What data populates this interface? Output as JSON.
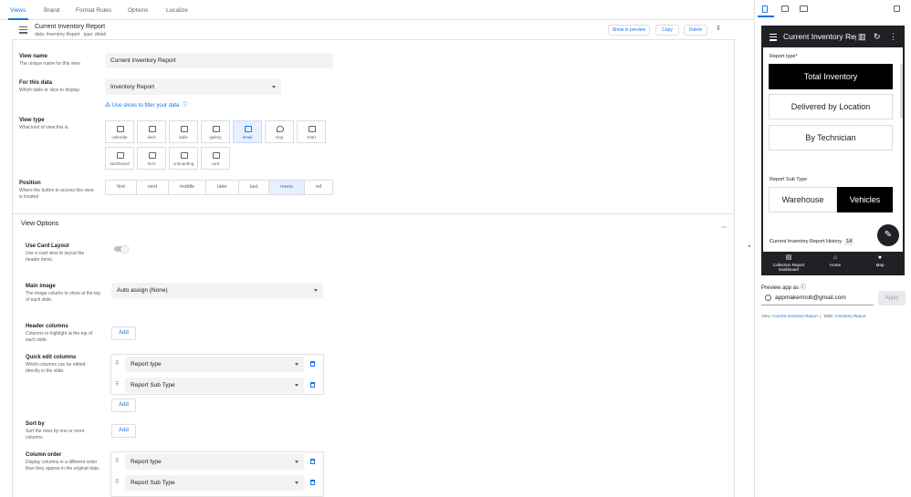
{
  "tabs": [
    "Views",
    "Brand",
    "Format Rules",
    "Options",
    "Localize"
  ],
  "header": {
    "title": "Current Inventory Report",
    "data_label": "data:",
    "data_value": "Inventory Report",
    "type_label": "type:",
    "type_value": "detail",
    "show_preview": "Show in preview",
    "copy": "Copy",
    "delete": "Delete"
  },
  "view_name": {
    "label": "View name",
    "help": "The unique name for this view.",
    "value": "Current Inventory Report"
  },
  "for_data": {
    "label": "For this data",
    "help": "Which table or slice to display.",
    "value": "Inventory Report",
    "slices_link": "Use slices to filter your data"
  },
  "view_type": {
    "label": "View type",
    "help": "What kind of view this is.",
    "options": [
      "calendar",
      "deck",
      "table",
      "gallery",
      "detail",
      "map",
      "chart",
      "dashboard",
      "form",
      "onboarding",
      "card"
    ],
    "selected": "detail"
  },
  "position": {
    "label": "Position",
    "help": "Where the button to access this view is located",
    "options": [
      "first",
      "next",
      "middle",
      "later",
      "last",
      "menu",
      "ref"
    ],
    "selected": "menu"
  },
  "view_options": {
    "title": "View Options",
    "card_layout": {
      "label": "Use Card Layout",
      "help": "Use a card view to layout the header items.",
      "enabled": false
    },
    "main_image": {
      "label": "Main image",
      "help": "The image column to show at the top of each slide.",
      "value": "Auto assign (None)"
    },
    "header_columns": {
      "label": "Header columns",
      "help": "Columns to highlight at the top of each slide.",
      "add": "Add"
    },
    "quick_edit": {
      "label": "Quick edit columns",
      "help": "Which columns can be edited directly in the slide.",
      "items": [
        "Report type",
        "Report Sub Type"
      ],
      "add": "Add"
    },
    "sort_by": {
      "label": "Sort by",
      "help": "Sort the rows by one or more columns.",
      "add": "Add"
    },
    "column_order": {
      "label": "Column order",
      "help": "Display columns in a different order than they appear in the original data.",
      "items": [
        "Report type",
        "Report Sub Type"
      ]
    }
  },
  "preview": {
    "app_title": "Current Inventory Report",
    "report_type_label": "Report type",
    "required_mark": "*",
    "report_type_options": [
      "Total Inventory",
      "Delivered by Location",
      "By Technician"
    ],
    "report_type_selected": "Total Inventory",
    "sub_type_label": "Report Sub Type",
    "sub_type_options": [
      "Warehouse",
      "Vehicles"
    ],
    "sub_type_selected": "Vehicles",
    "history_label": "Current Inventory Report History",
    "history_count": "14",
    "nav": [
      "Collection Report Dashboard",
      "Home",
      "Map"
    ],
    "preview_as_label": "Preview app as",
    "email": "appmakermob@gmail.com",
    "apply": "Apply",
    "footer": {
      "view_label": "View:",
      "view_name": "Current Inventory Report",
      "sep": "|",
      "table_label": "Table:",
      "table_name": "Inventory Report"
    }
  },
  "colors": {
    "accent": "#1a73e8",
    "dark": "#202124",
    "field_bg": "#f1f3f4",
    "selected_bg": "#e8f0fe"
  },
  "icons": [
    "list-icon",
    "calendar-icon",
    "deck-icon",
    "table-icon",
    "gallery-icon",
    "detail-icon",
    "map-icon",
    "chart-icon",
    "dashboard-icon",
    "form-icon",
    "onboarding-icon",
    "card-icon",
    "drag-handle-icon",
    "trash-icon",
    "phone-icon",
    "tablet-icon",
    "desktop-icon",
    "expand-icon",
    "menu-icon",
    "edit-icon",
    "home-icon",
    "map-pin-icon"
  ]
}
